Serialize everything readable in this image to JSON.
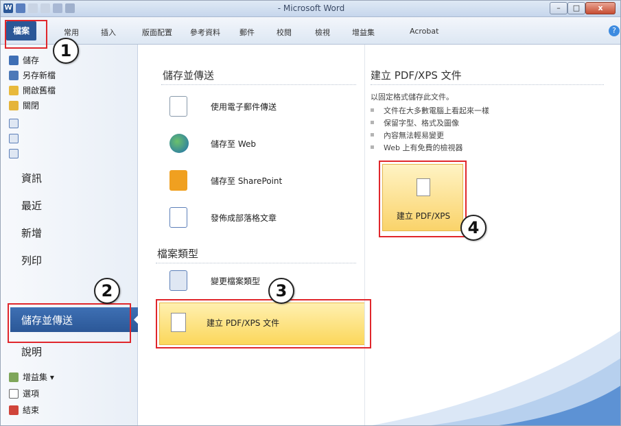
{
  "window": {
    "title": "- Microsoft Word",
    "app_icon": "W",
    "controls": [
      "minimize-icon",
      "maximize-icon",
      "close-icon"
    ],
    "minimize_symbol": "–",
    "maximize_symbol": "□",
    "close_symbol": "x"
  },
  "ribbon": {
    "file_tab": "檔案",
    "tabs": [
      "常用",
      "插入",
      "版面配置",
      "參考資料",
      "郵件",
      "校閱",
      "檢視",
      "增益集",
      "Acrobat"
    ],
    "help_symbol": "?"
  },
  "left_nav": {
    "small_items": [
      {
        "label": "儲存",
        "icon": "save-icon"
      },
      {
        "label": "另存新檔",
        "icon": "save-as-icon"
      },
      {
        "label": "開啟舊檔",
        "icon": "open-folder-icon"
      },
      {
        "label": "關閉",
        "icon": "close-folder-icon"
      }
    ],
    "recent_doc_icons": [
      "word-doc-icon",
      "word-doc-icon",
      "word-doc-icon"
    ],
    "big_items": [
      "資訊",
      "最近",
      "新增",
      "列印"
    ],
    "selected_item": "儲存並傳送",
    "help_item": "說明",
    "bottom_items": [
      {
        "label": "增益集",
        "icon": "add-ins-icon",
        "suffix": "▾"
      },
      {
        "label": "選項",
        "icon": "options-icon"
      },
      {
        "label": "結束",
        "icon": "exit-icon"
      }
    ]
  },
  "save_send": {
    "heading": "儲存並傳送",
    "items": [
      {
        "label": "使用電子郵件傳送",
        "icon": "email-send-icon"
      },
      {
        "label": "儲存至 Web",
        "icon": "globe-icon"
      },
      {
        "label": "儲存至 SharePoint",
        "icon": "sharepoint-icon"
      },
      {
        "label": "發佈成部落格文章",
        "icon": "blog-icon"
      }
    ]
  },
  "file_types": {
    "heading": "檔案類型",
    "items": [
      {
        "label": "變更檔案類型",
        "icon": "change-file-type-icon"
      },
      {
        "label": "建立 PDF/XPS 文件",
        "icon": "pdf-document-icon"
      }
    ]
  },
  "pdf_panel": {
    "heading": "建立 PDF/XPS 文件",
    "description": "以固定格式儲存此文件。",
    "bullets": [
      "文件在大多數電腦上看起來一樣",
      "保留字型、格式及圖像",
      "內容無法輕易變更",
      "Web 上有免費的檢視器"
    ],
    "button_label": "建立 PDF/XPS"
  },
  "callouts": [
    "1",
    "2",
    "3",
    "4"
  ],
  "colors": {
    "file_tab": "#2b5797",
    "selected_nav": "#2b5797",
    "highlight": "#fbd75b",
    "annotation_red": "#e0262b"
  }
}
